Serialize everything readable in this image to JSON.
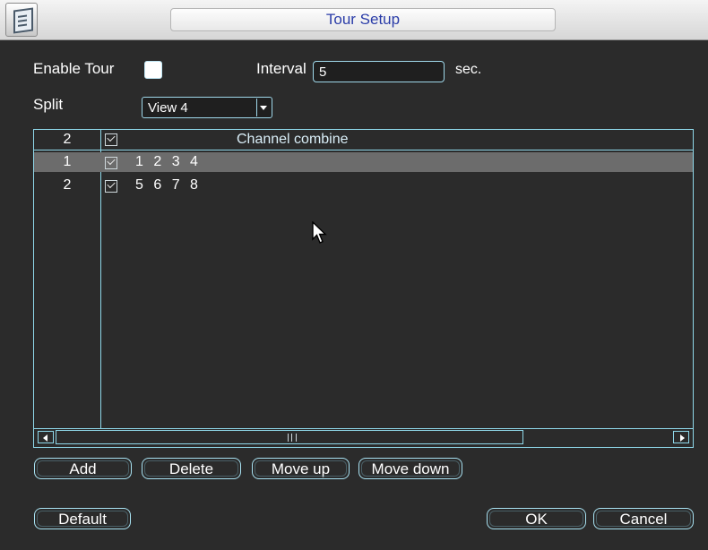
{
  "window": {
    "title": "Tour Setup"
  },
  "settings": {
    "enable_tour_label": "Enable Tour",
    "enable_tour_checked": false,
    "interval_label": "Interval",
    "interval_value": "5",
    "interval_unit": "sec.",
    "split_label": "Split",
    "split_value": "View 4"
  },
  "table": {
    "header": {
      "count": "2",
      "checked": true,
      "title": "Channel combine"
    },
    "rows": [
      {
        "num": "1",
        "checked": true,
        "channels": "1 2 3 4",
        "selected": true
      },
      {
        "num": "2",
        "checked": true,
        "channels": "5 6 7 8",
        "selected": false
      }
    ]
  },
  "buttons": {
    "add": "Add",
    "delete": "Delete",
    "move_up": "Move up",
    "move_down": "Move down",
    "default": "Default",
    "ok": "OK",
    "cancel": "Cancel"
  },
  "icons": [
    "app-icon",
    "dropdown-arrow-icon",
    "scroll-left-icon",
    "scroll-right-icon",
    "mouse-cursor-icon"
  ]
}
